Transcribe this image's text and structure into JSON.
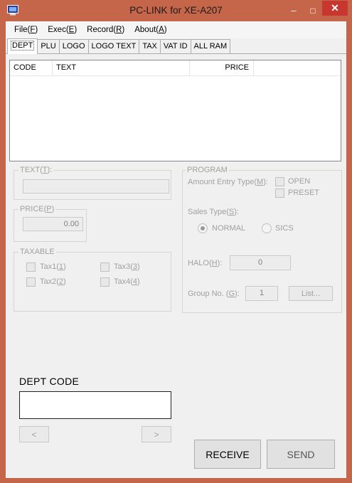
{
  "window": {
    "title": "PC-LINK for XE-A207",
    "minimize_glyph": "–",
    "maximize_glyph": "□",
    "close_glyph": "✕"
  },
  "menu": {
    "items": [
      {
        "label": "File(",
        "key": "F",
        "end": ")"
      },
      {
        "label": "Exec(",
        "key": "E",
        "end": ")"
      },
      {
        "label": "Record(",
        "key": "R",
        "end": ")"
      },
      {
        "label": "About(",
        "key": "A",
        "end": ")"
      }
    ]
  },
  "tabs": [
    "DEPT",
    "PLU",
    "LOGO",
    "LOGO TEXT",
    "TAX",
    "VAT ID",
    "ALL RAM"
  ],
  "list": {
    "columns": [
      "CODE",
      "TEXT",
      "PRICE"
    ]
  },
  "text_group": {
    "label": "TEXT(",
    "key": "T",
    "end": "):"
  },
  "price_group": {
    "label": "PRICE(",
    "key": "P",
    "end": ")",
    "value": "0.00"
  },
  "taxable_group": {
    "label": "TAXABLE",
    "items": [
      {
        "label": "Tax1(",
        "key": "1",
        "end": ")"
      },
      {
        "label": "Tax3(",
        "key": "3",
        "end": ")"
      },
      {
        "label": "Tax2(",
        "key": "2",
        "end": ")"
      },
      {
        "label": "Tax4(",
        "key": "4",
        "end": ")"
      }
    ]
  },
  "program_group": {
    "label": "PROGRAM",
    "amount_entry": {
      "label": "Amount Entry Type(",
      "key": "M",
      "end": "):"
    },
    "open_label": "OPEN",
    "preset_label": "PRESET",
    "sales_type": {
      "label": "Sales Type(",
      "key": "S",
      "end": "):"
    },
    "normal_label": "NORMAL",
    "sics_label": "SICS",
    "sales_type_selected": "NORMAL",
    "halo": {
      "label": "HALO(",
      "key": "H",
      "end": "):",
      "value": "0"
    },
    "group_no": {
      "label": "Group No. (",
      "key": "G",
      "end": "):",
      "value": "1"
    },
    "list_button": "List..."
  },
  "dept_code": {
    "label": "DEPT CODE",
    "value": ""
  },
  "nav": {
    "prev": "<",
    "next": ">"
  },
  "actions": {
    "receive": "RECEIVE",
    "send": "SEND"
  },
  "colors": {
    "titlebar": "#c5654a",
    "close_button": "#c7372f",
    "window_bg": "#f0f0f0"
  }
}
